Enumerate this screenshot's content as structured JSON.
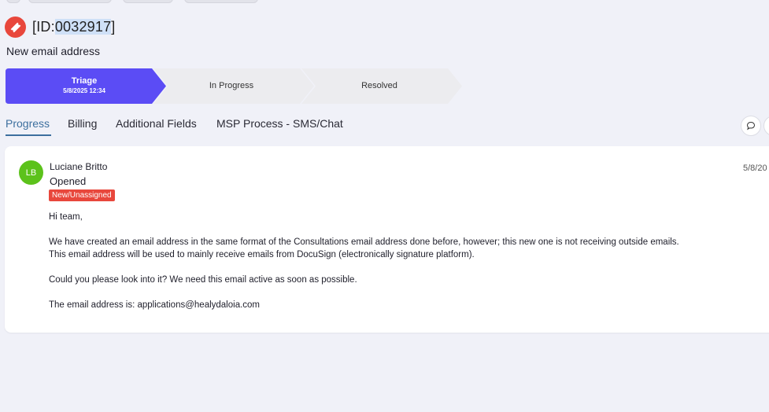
{
  "ticket": {
    "id_prefix": "[ID:",
    "id_number": "0032917",
    "id_suffix": "]",
    "subject": "New email address"
  },
  "stages": [
    {
      "label": "Triage",
      "date": "5/8/2025 12:34",
      "active": true
    },
    {
      "label": "In Progress",
      "active": false
    },
    {
      "label": "Resolved",
      "active": false
    }
  ],
  "tabs": [
    {
      "label": "Progress",
      "active": true
    },
    {
      "label": "Billing"
    },
    {
      "label": "Additional Fields"
    },
    {
      "label": "MSP Process - SMS/Chat"
    }
  ],
  "entry": {
    "avatar_initials": "LB",
    "author": "Luciane Britto",
    "action": "Opened",
    "badge": "New/Unassigned",
    "date": "5/8/20",
    "message": {
      "line1": "Hi team,",
      "line2": "We have created an email address in the same format of the Consultations email address done before, however; this new one is not receiving outside emails.",
      "line3": "This email address will be used to mainly receive emails from DocuSign (electronically signature platform).",
      "line4": "Could you please look into it? We need this email active as soon as possible.",
      "line5": "The email address is: applications@healydaloia.com"
    }
  },
  "colors": {
    "accent": "#5b4cf5",
    "stage_inactive": "#ececef",
    "badge": "#e8473c",
    "avatar": "#5cc21b",
    "tab_active": "#3c6f9e"
  },
  "icons": {
    "ticket": "ticket-icon",
    "comment": "comment-icon"
  }
}
